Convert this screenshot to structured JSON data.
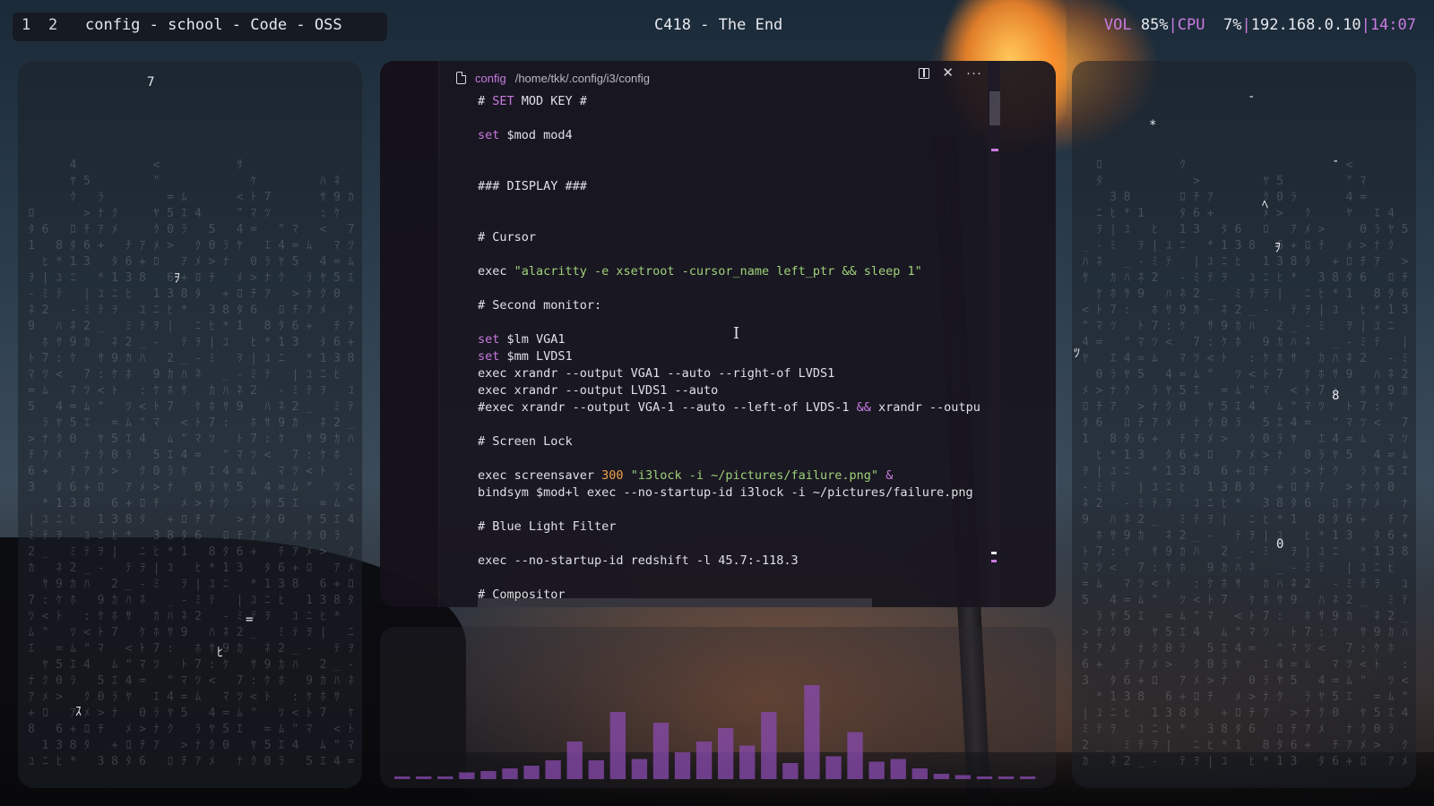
{
  "workspaces": [
    "1",
    "2"
  ],
  "window_title": "config - school - Code - OSS",
  "now_playing": "C418 - The End",
  "status": {
    "vol_label": "VOL",
    "vol_value": "85%",
    "sep": "|",
    "cpu_label": "CPU",
    "cpu_value": " 7%",
    "ip": "192.168.0.10",
    "time": "14:07"
  },
  "editor": {
    "tab_name": "config",
    "tab_path": "/home/tkk/.config/i3/config",
    "split_icon": "split-editor-icon",
    "close_icon": "close-icon",
    "more_icon": "more-actions-icon",
    "lines": [
      [
        {
          "t": "# ",
          "c": ""
        },
        {
          "t": "SET",
          "c": "kw"
        },
        {
          "t": " MOD KEY #",
          "c": ""
        }
      ],
      [],
      [
        {
          "t": "set",
          "c": "kw"
        },
        {
          "t": " $mod mod4",
          "c": ""
        }
      ],
      [],
      [],
      [
        {
          "t": "### DISPLAY ###",
          "c": ""
        }
      ],
      [],
      [],
      [
        {
          "t": "# Cursor",
          "c": ""
        }
      ],
      [],
      [
        {
          "t": "exec ",
          "c": ""
        },
        {
          "t": "\"alacritty -e xsetroot -cursor_name left_ptr && sleep 1\"",
          "c": "str"
        }
      ],
      [],
      [
        {
          "t": "# Second monitor:",
          "c": ""
        }
      ],
      [],
      [
        {
          "t": "set",
          "c": "kw"
        },
        {
          "t": " $lm VGA1",
          "c": ""
        }
      ],
      [
        {
          "t": "set",
          "c": "kw"
        },
        {
          "t": " $mm LVDS1",
          "c": ""
        }
      ],
      [
        {
          "t": "exec xrandr --output VGA1 --auto --right-of LVDS1",
          "c": ""
        }
      ],
      [
        {
          "t": "exec xrandr --output LVDS1 --auto",
          "c": ""
        }
      ],
      [
        {
          "t": "#exec xrandr --output VGA-1 --auto --left-of LVDS-1 ",
          "c": ""
        },
        {
          "t": "&&",
          "c": "kw"
        },
        {
          "t": " xrandr --outpu",
          "c": ""
        }
      ],
      [],
      [
        {
          "t": "# Screen Lock",
          "c": ""
        }
      ],
      [],
      [
        {
          "t": "exec screensaver ",
          "c": ""
        },
        {
          "t": "300",
          "c": "num"
        },
        {
          "t": " ",
          "c": ""
        },
        {
          "t": "\"i3lock -i ~/pictures/failure.png\"",
          "c": "str"
        },
        {
          "t": " ",
          "c": ""
        },
        {
          "t": "&",
          "c": "kw"
        }
      ],
      [
        {
          "t": "bindsym $mod+l exec --no-startup-id i3lock -i ~/pictures/failure.png",
          "c": ""
        }
      ],
      [],
      [
        {
          "t": "# Blue Light Filter",
          "c": ""
        }
      ],
      [],
      [
        {
          "t": "exec --no-startup-id redshift -l 45.7:-118.3",
          "c": ""
        }
      ],
      [],
      [
        {
          "t": "# Compositor",
          "c": ""
        }
      ]
    ]
  },
  "matrix_left_highlights": [
    "7",
    "ｦ",
    "=",
    "ﾋ",
    "ｽ"
  ],
  "matrix_right_highlights": [
    "-",
    "*",
    "-",
    "ﾍ",
    "ｦ",
    "ﾂ",
    "8",
    "0"
  ],
  "matrix_col_text": "ｱ3ｦﾊ7=ｸ+ﾋ-ｻﾂ5ﾒ8|ﾈ:ﾑ0ﾛ*ﾐ9<ｴ>ﾀﾕ2ｹ\"ﾗﾁ1ﾃｶﾄ4ﾅ6ﾆ_ﾎﾏﾔ",
  "visualizer": {
    "color": "#8a4bb0",
    "levels": [
      0.02,
      0.02,
      0.02,
      0.05,
      0.06,
      0.08,
      0.1,
      0.14,
      0.28,
      0.14,
      0.5,
      0.15,
      0.42,
      0.2,
      0.28,
      0.38,
      0.25,
      0.5,
      0.12,
      0.7,
      0.17,
      0.35,
      0.13,
      0.15,
      0.08,
      0.04,
      0.03,
      0.02,
      0.02,
      0.02
    ]
  }
}
